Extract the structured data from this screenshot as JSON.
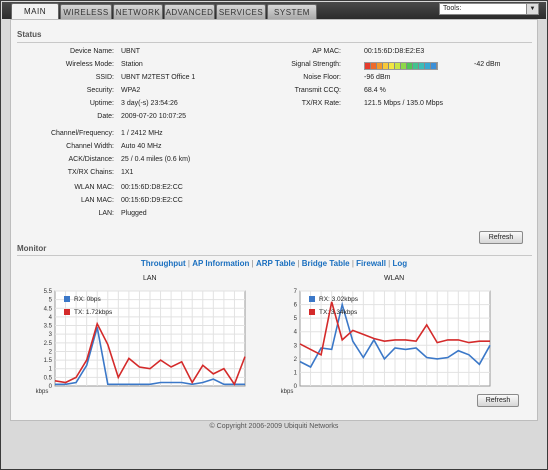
{
  "tabs": [
    "MAIN",
    "WIRELESS",
    "NETWORK",
    "ADVANCED",
    "SERVICES",
    "SYSTEM"
  ],
  "tools": {
    "label": "Tools:"
  },
  "status": {
    "title": "Status",
    "left": [
      {
        "label": "Device Name:",
        "value": "UBNT"
      },
      {
        "label": "Wireless Mode:",
        "value": "Station"
      },
      {
        "label": "SSID:",
        "value": "UBNT M2TEST Office 1"
      },
      {
        "label": "Security:",
        "value": "WPA2"
      },
      {
        "label": "Uptime:",
        "value": "3 day(-s) 23:54:26"
      },
      {
        "label": "Date:",
        "value": "2009-07-20 10:07:25"
      },
      {
        "label": "Channel/Frequency:",
        "value": "1 / 2412 MHz"
      },
      {
        "label": "Channel Width:",
        "value": "Auto 40 MHz"
      },
      {
        "label": "ACK/Distance:",
        "value": "25 / 0.4 miles (0.6 km)"
      },
      {
        "label": "TX/RX Chains:",
        "value": "1X1"
      },
      {
        "label": "WLAN MAC:",
        "value": "00:15:6D:D8:E2:CC"
      },
      {
        "label": "LAN MAC:",
        "value": "00:15:6D:D9:E2:CC"
      },
      {
        "label": "LAN:",
        "value": "Plugged"
      }
    ],
    "right": [
      {
        "label": "AP MAC:",
        "value": "00:15:6D:D8:E2:E3"
      },
      {
        "label": "Signal Strength:",
        "value": "-42 dBm"
      },
      {
        "label": "Noise Floor:",
        "value": "-96 dBm"
      },
      {
        "label": "Transmit CCQ:",
        "value": "68.4 %"
      },
      {
        "label": "TX/RX Rate:",
        "value": "121.5 Mbps  / 135.0 Mbps"
      }
    ],
    "signal_colors": [
      "#e53b2c",
      "#ee6a2a",
      "#f39a2a",
      "#f7c93a",
      "#f2e642",
      "#c9e544",
      "#8fd848",
      "#4fc657",
      "#43c28f",
      "#3cbdb6",
      "#38a8d2",
      "#3a8fd8"
    ],
    "refresh_label": "Refresh"
  },
  "monitor": {
    "title": "Monitor",
    "links": [
      "Throughput",
      "AP Information",
      "ARP Table",
      "Bridge Table",
      "Firewall",
      "Log"
    ],
    "refresh_label": "Refresh"
  },
  "chart_data": [
    {
      "type": "line",
      "title": "LAN",
      "ylabel": "kbps",
      "ylim": [
        0,
        5.5
      ],
      "yticks": [
        "0",
        "0.5",
        "1",
        "1.5",
        "2",
        "2.5",
        "3",
        "3.5",
        "4",
        "4.5",
        "5",
        "5.5"
      ],
      "legend_placement": "top-left",
      "series": [
        {
          "name": "RX: 0bps",
          "color": "#3b78c8",
          "values": [
            0.1,
            0.1,
            0.2,
            1.2,
            3.4,
            0.1,
            0.1,
            0.1,
            0.1,
            0.1,
            0.2,
            0.2,
            0.2,
            0.1,
            0.2,
            0.4,
            0.1,
            0.1,
            0.1
          ]
        },
        {
          "name": "TX: 1.72kbps",
          "color": "#d42a2a",
          "values": [
            0.3,
            0.2,
            0.5,
            1.5,
            3.6,
            2.4,
            0.5,
            1.6,
            1.1,
            1.0,
            1.5,
            1.1,
            1.4,
            0.2,
            1.2,
            0.7,
            1.0,
            0.1,
            1.7
          ]
        }
      ]
    },
    {
      "type": "line",
      "title": "WLAN",
      "ylabel": "kbps",
      "ylim": [
        0,
        7
      ],
      "yticks": [
        "0",
        "1",
        "2",
        "3",
        "4",
        "5",
        "6",
        "7"
      ],
      "legend_placement": "top-left",
      "series": [
        {
          "name": "RX: 3.02kbps",
          "color": "#3b78c8",
          "values": [
            1.8,
            1.4,
            2.8,
            2.7,
            6.0,
            3.3,
            2.1,
            3.4,
            2.0,
            2.8,
            2.7,
            2.8,
            2.1,
            2.0,
            2.1,
            2.6,
            2.3,
            1.6,
            3.0
          ]
        },
        {
          "name": "TX: 3.34kbps",
          "color": "#d42a2a",
          "values": [
            3.1,
            2.7,
            2.3,
            6.2,
            3.4,
            4.1,
            3.8,
            3.5,
            3.3,
            3.4,
            3.4,
            3.3,
            4.5,
            3.2,
            3.4,
            3.4,
            3.2,
            3.3,
            3.3
          ]
        }
      ]
    }
  ],
  "footer": "© Copyright 2006-2009 Ubiquiti Networks"
}
